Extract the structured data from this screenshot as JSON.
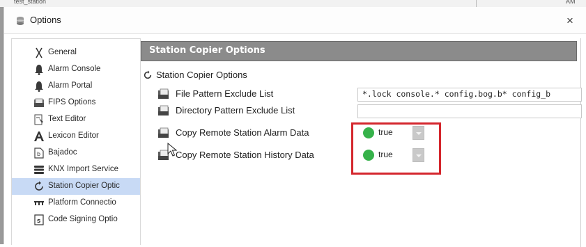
{
  "background_window": {
    "title": "test_station",
    "clock": "AM"
  },
  "dialog": {
    "title": "Options",
    "close_glyph": "×"
  },
  "sidebar": {
    "items": [
      {
        "label": "General",
        "icon": "wrench-icon"
      },
      {
        "label": "Alarm Console",
        "icon": "bell-icon"
      },
      {
        "label": "Alarm Portal",
        "icon": "bell-icon"
      },
      {
        "label": "FIPS Options",
        "icon": "folder-icon"
      },
      {
        "label": "Text Editor",
        "icon": "text-editor-icon"
      },
      {
        "label": "Lexicon Editor",
        "icon": "lexicon-icon"
      },
      {
        "label": "Bajadoc",
        "icon": "document-icon"
      },
      {
        "label": "KNX Import Service",
        "icon": "database-icon"
      },
      {
        "label": "Station Copier Optic",
        "icon": "copier-icon",
        "selected": true
      },
      {
        "label": "Platform Connectio",
        "icon": "connection-icon"
      },
      {
        "label": "Code Signing Optio",
        "icon": "code-signing-icon"
      }
    ]
  },
  "panel": {
    "header": "Station Copier Options",
    "root_label": "Station Copier Options",
    "properties": [
      {
        "label": "File Pattern Exclude List",
        "value": "*.lock console.* config.bog.b* config_b"
      },
      {
        "label": "Directory Pattern Exclude List",
        "value": ""
      },
      {
        "label": "Copy Remote Station Alarm Data",
        "value": "true"
      },
      {
        "label": "Copy Remote Station History Data",
        "value": "true"
      }
    ]
  },
  "colors": {
    "header_band": "#8b8b8b",
    "selection": "#c8daf5",
    "status_green": "#36b24a",
    "highlight_red": "#d4262d"
  }
}
